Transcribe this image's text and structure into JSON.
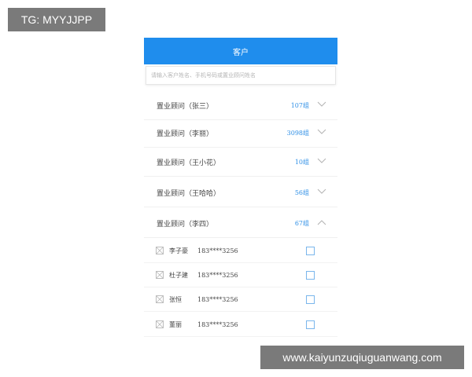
{
  "watermarks": {
    "top": "TG: MYYJJPP",
    "bottom": "www.kaiyunzuqiuguanwang.com"
  },
  "header": {
    "title": "客户"
  },
  "search": {
    "placeholder": "请输入客户姓名、手机号码或置业顾问姓名"
  },
  "groups": [
    {
      "label": "置业顾问（张三）",
      "count": "107组",
      "expanded": false,
      "chevron": "chevron-down-icon"
    },
    {
      "label": "置业顾问（李丽）",
      "count": "3098组",
      "expanded": false,
      "chevron": "chevron-down-icon"
    },
    {
      "label": "置业顾问（王小花）",
      "count": "10组",
      "expanded": false,
      "chevron": "chevron-down-icon"
    },
    {
      "label": "置业顾问（王哈哈）",
      "count": "56组",
      "expanded": false,
      "chevron": "chevron-down-icon"
    },
    {
      "label": "置业顾问（李四）",
      "count": "67组",
      "expanded": true,
      "chevron": "chevron-up-icon"
    }
  ],
  "members": [
    {
      "name": "李子豪",
      "phone": "183****3256",
      "checked": false
    },
    {
      "name": "杜子建",
      "phone": "183****3256",
      "checked": false
    },
    {
      "name": "张恒",
      "phone": "183****3256",
      "checked": false
    },
    {
      "name": "董丽",
      "phone": "183****3256",
      "checked": false
    }
  ],
  "colors": {
    "header_bg": "#1f8ded",
    "count_text": "#2e8fe6",
    "checkbox_border": "#7ab6ec",
    "watermark_bg": "#7a7a7a"
  }
}
